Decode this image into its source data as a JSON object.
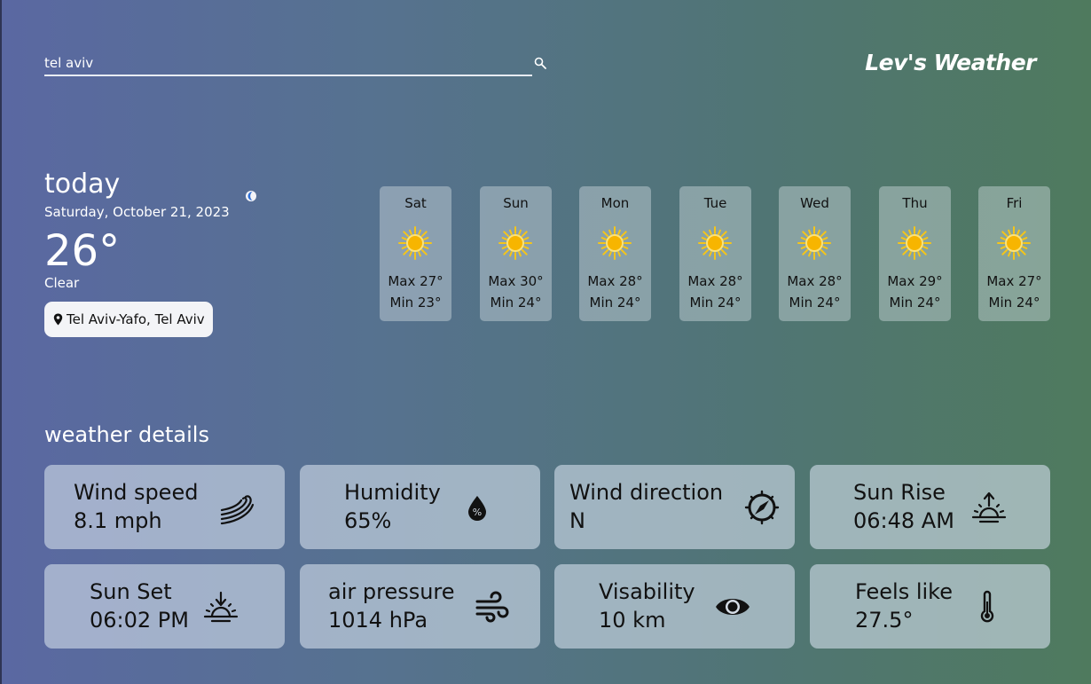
{
  "search": {
    "value": "tel aviv",
    "placeholder": "",
    "icon": "search-icon"
  },
  "brand": {
    "title": "Lev's Weather"
  },
  "current": {
    "heading": "today",
    "date": "Saturday, October 21, 2023",
    "temperature": "26°",
    "condition": "Clear",
    "condition_icon": "moon-icon",
    "location": "Tel Aviv-Yafo, Tel Aviv"
  },
  "forecast": [
    {
      "day": "Sat",
      "max": "Max 27°",
      "min": "Min 23°",
      "icon": "sun-icon"
    },
    {
      "day": "Sun",
      "max": "Max 30°",
      "min": "Min 24°",
      "icon": "sun-icon"
    },
    {
      "day": "Mon",
      "max": "Max 28°",
      "min": "Min 24°",
      "icon": "sun-icon"
    },
    {
      "day": "Tue",
      "max": "Max 28°",
      "min": "Min 24°",
      "icon": "sun-icon"
    },
    {
      "day": "Wed",
      "max": "Max 28°",
      "min": "Min 24°",
      "icon": "sun-icon"
    },
    {
      "day": "Thu",
      "max": "Max 29°",
      "min": "Min 24°",
      "icon": "sun-icon"
    },
    {
      "day": "Fri",
      "max": "Max 27°",
      "min": "Min 24°",
      "icon": "sun-icon"
    }
  ],
  "details": {
    "title": "weather details",
    "cards": [
      {
        "label": "Wind speed",
        "value": "8.1 mph",
        "icon": "wind-speed-icon"
      },
      {
        "label": "Humidity",
        "value": "65%",
        "icon": "humidity-icon"
      },
      {
        "label": "Wind direction",
        "value": "N",
        "icon": "compass-icon"
      },
      {
        "label": "Sun Rise",
        "value": "06:48 AM",
        "icon": "sunrise-icon"
      },
      {
        "label": "Sun Set",
        "value": "06:02 PM",
        "icon": "sunset-icon"
      },
      {
        "label": "air pressure",
        "value": "1014 hPa",
        "icon": "air-pressure-icon"
      },
      {
        "label": "Visability",
        "value": "10 km",
        "icon": "eye-icon"
      },
      {
        "label": "Feels like",
        "value": "27.5°",
        "icon": "thermometer-icon"
      }
    ]
  },
  "colors": {
    "sun": "#f5c518",
    "sun_core": "#f7b500",
    "moon": "#2f6fd6",
    "card_text": "#111111"
  }
}
